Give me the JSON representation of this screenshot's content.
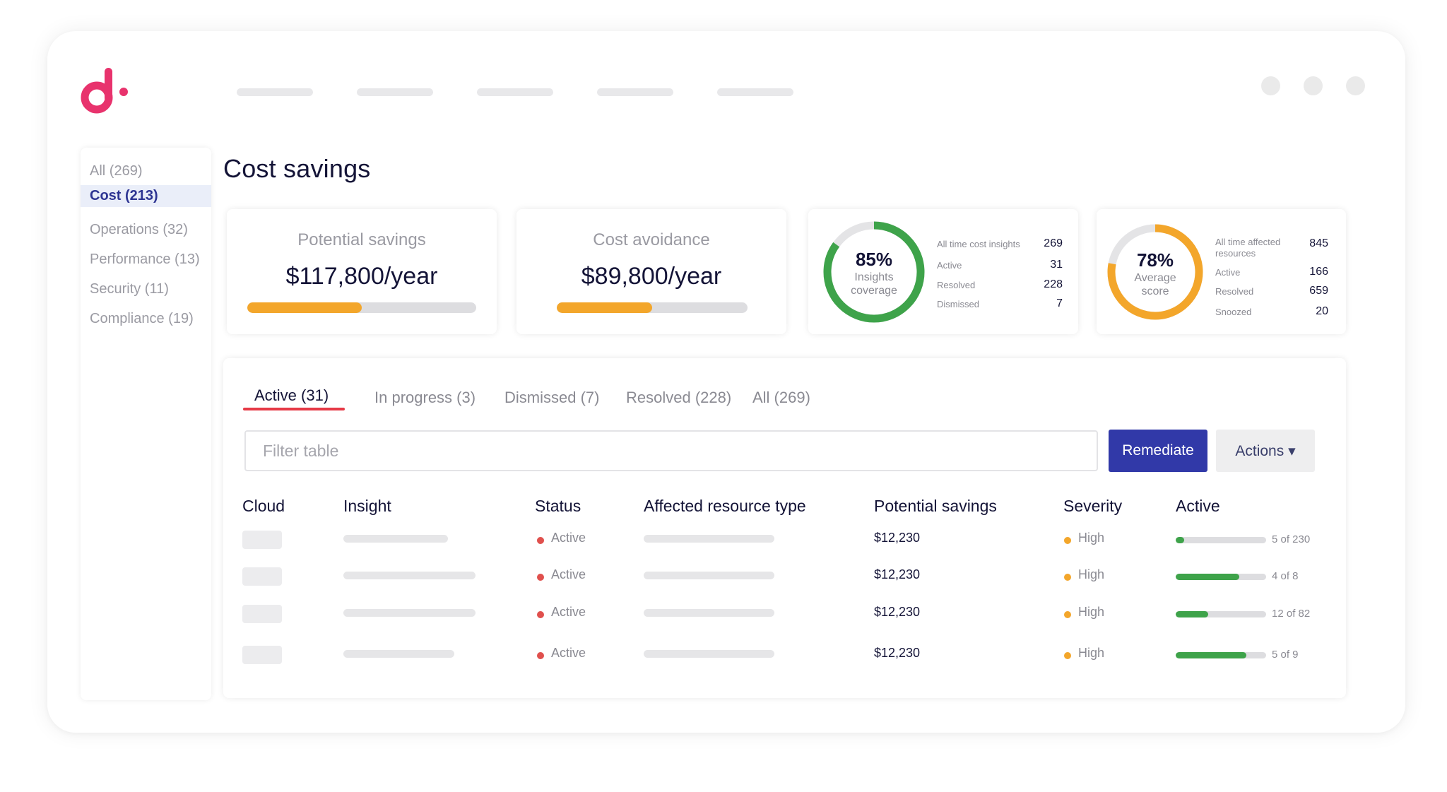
{
  "nav": {
    "pill_count": 5,
    "window_dots": 3
  },
  "sidebar": {
    "items": [
      {
        "label": "All (269)",
        "active": false
      },
      {
        "label": "Cost (213)",
        "active": true
      },
      {
        "label": "Operations (32)",
        "active": false
      },
      {
        "label": "Performance (13)",
        "active": false
      },
      {
        "label": "Security (11)",
        "active": false
      },
      {
        "label": "Compliance (19)",
        "active": false
      }
    ]
  },
  "page": {
    "title": "Cost savings"
  },
  "kpis": [
    {
      "label": "Potential savings",
      "value": "$117,800/year",
      "progress": 0.5
    },
    {
      "label": "Cost avoidance",
      "value": "$89,800/year",
      "progress": 0.5
    }
  ],
  "coverage": {
    "percent": "85%",
    "line1": "Insights",
    "line2": "coverage",
    "fraction": 0.85,
    "color": "#3ea34a",
    "stats": [
      {
        "label": "All time cost insights",
        "value": "269"
      },
      {
        "label": "Active",
        "value": "31"
      },
      {
        "label": "Resolved",
        "value": "228"
      },
      {
        "label": "Dismissed",
        "value": "7"
      }
    ]
  },
  "score": {
    "percent": "78%",
    "line1": "Average",
    "line2": "score",
    "fraction": 0.78,
    "color": "#f3a62b",
    "stats": [
      {
        "label_line1": "All time affected",
        "label_line2": "resources",
        "value": "845"
      },
      {
        "label": "Active",
        "value": "166"
      },
      {
        "label": "Resolved",
        "value": "659"
      },
      {
        "label": "Snoozed",
        "value": "20"
      }
    ]
  },
  "tabs": [
    {
      "label": "Active (31)",
      "active": true
    },
    {
      "label": "In progress (3)",
      "active": false
    },
    {
      "label": "Dismissed (7)",
      "active": false
    },
    {
      "label": "Resolved (228)",
      "active": false
    },
    {
      "label": "All (269)",
      "active": false
    }
  ],
  "filter": {
    "placeholder": "Filter table",
    "value": ""
  },
  "buttons": {
    "remediate": "Remediate",
    "actions": "Actions ▾"
  },
  "table": {
    "columns": [
      "Cloud",
      "Insight",
      "Status",
      "Affected resource type",
      "Potential savings",
      "Severity",
      "Active"
    ],
    "rows": [
      {
        "status": "Active",
        "savings": "$12,230",
        "severity": "High",
        "active_text": "5 of 230",
        "active_fraction": 0.02
      },
      {
        "status": "Active",
        "savings": "$12,230",
        "severity": "High",
        "active_text": "4 of 8",
        "active_fraction": 0.7
      },
      {
        "status": "Active",
        "savings": "$12,230",
        "severity": "High",
        "active_text": "12 of 82",
        "active_fraction": 0.36
      },
      {
        "status": "Active",
        "savings": "$12,230",
        "severity": "High",
        "active_text": "5 of 9",
        "active_fraction": 0.78
      }
    ]
  },
  "colors": {
    "brand": "#e8336d",
    "primary_button": "#3139a8",
    "status_active": "#e0504d",
    "severity_high": "#f3a62b",
    "progress_green": "#3ea34a",
    "tab_underline": "#e63946"
  }
}
